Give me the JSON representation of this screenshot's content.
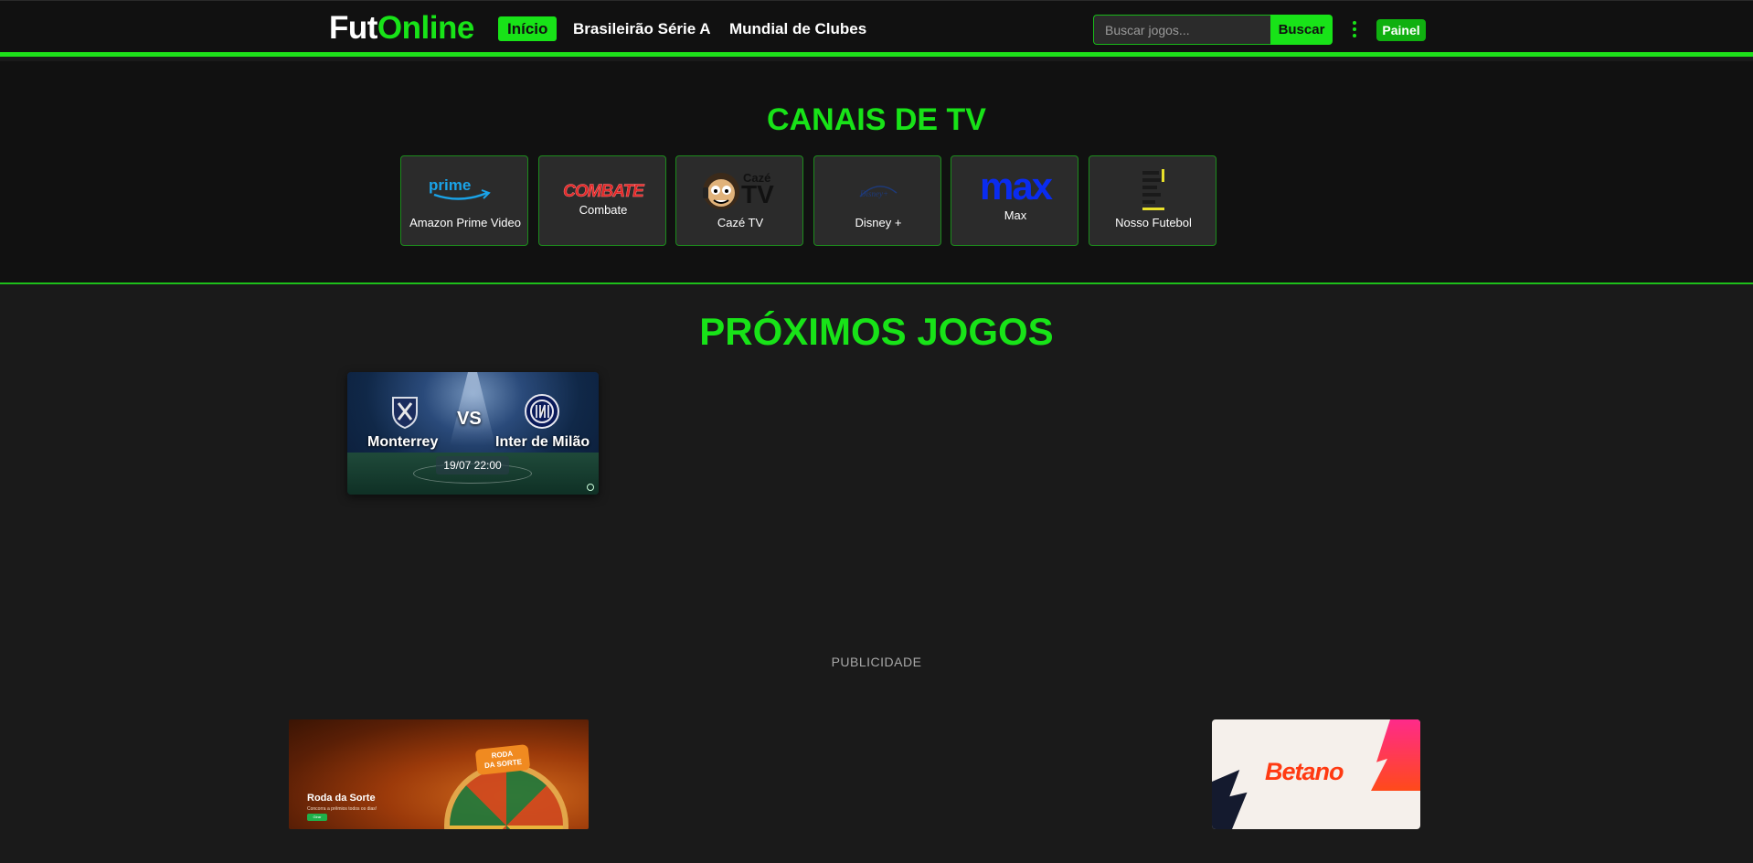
{
  "header": {
    "logo_part1": "Fut",
    "logo_part2": "Online",
    "nav": [
      {
        "label": "Início",
        "active": true
      },
      {
        "label": "Brasileirão Série A",
        "active": false
      },
      {
        "label": "Mundial de Clubes",
        "active": false
      }
    ],
    "search": {
      "placeholder": "Buscar jogos...",
      "value": "",
      "button_label": "Buscar"
    },
    "menu_icon": "kebab-menu-icon",
    "panel_label": "Painel"
  },
  "canais": {
    "title": "CANAIS DE TV",
    "channels": [
      {
        "name": "Amazon Prime Video",
        "logo_text": "prime",
        "icon": "amazon-prime-logo"
      },
      {
        "name": "Combate",
        "logo_text": "COMBATE",
        "icon": "combate-logo"
      },
      {
        "name": "Cazé TV",
        "logo_text_top": "Cazé",
        "logo_text_bottom": "TV",
        "icon": "caze-tv-logo"
      },
      {
        "name": "Disney +",
        "logo_text": "Disney+",
        "icon": "disney-plus-logo"
      },
      {
        "name": "Max",
        "logo_text": "max",
        "icon": "max-logo"
      },
      {
        "name": "Nosso Futebol",
        "icon": "nosso-futebol-logo"
      }
    ]
  },
  "proximos_jogos": {
    "title": "PRÓXIMOS JOGOS",
    "matches": [
      {
        "home": "Monterrey",
        "away": "Inter de Milão",
        "vs": "VS",
        "datetime": "19/07 22:00"
      }
    ]
  },
  "publicidade": {
    "label": "PUBLICIDADE",
    "ads": [
      {
        "title": "Roda da Sorte",
        "subtitle": "Concorra a prêmios todos os dias!",
        "button": "Girar",
        "badge_line1": "RODA",
        "badge_line2": "DA SORTE"
      },
      {
        "brand": "Betano"
      }
    ]
  },
  "colors": {
    "accent": "#18e318",
    "header_bg": "#111111",
    "body_bg": "#1a1a1a",
    "card_bg": "#2b2b2b",
    "betano": "#ff3a12",
    "max_blue": "#0a2cf0"
  }
}
